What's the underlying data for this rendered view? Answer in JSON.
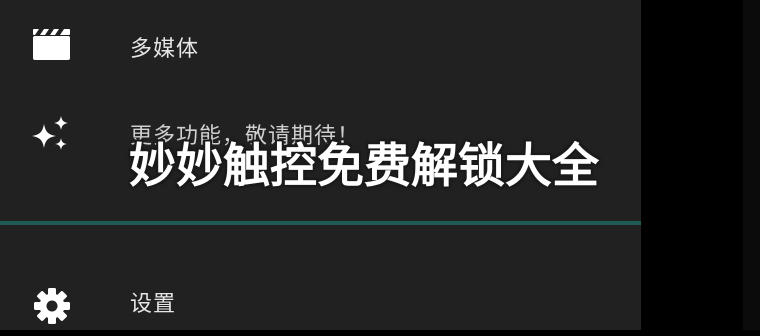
{
  "drawer": {
    "items": [
      {
        "label": "多媒体",
        "icon": "clapperboard-icon"
      },
      {
        "label": "更多功能，敬请期待！",
        "icon": "sparkles-icon"
      },
      {
        "label": "设置",
        "icon": "gear-icon"
      }
    ]
  },
  "overlay": {
    "title": "妙妙触控免费解锁大全"
  },
  "colors": {
    "drawer_background": "#212121",
    "divider": "#1f5a54",
    "text": "#e6e6e6",
    "overlay_text": "#ffffff"
  }
}
